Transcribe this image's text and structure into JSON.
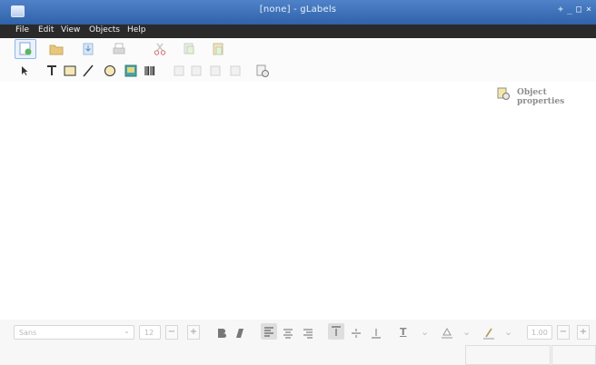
{
  "window": {
    "title": "[none] - gLabels",
    "controls": [
      "+",
      "_",
      "□",
      "×"
    ]
  },
  "menubar": {
    "items": [
      "File",
      "Edit",
      "View",
      "Objects",
      "Help"
    ]
  },
  "icons": {
    "toolbar1": [
      "new-icon",
      "open-icon",
      "save-icon",
      "print-icon",
      "cut-icon",
      "copy-icon",
      "paste-icon"
    ],
    "toolbar2": [
      "arrow-icon",
      "text-icon",
      "box-icon",
      "line-icon",
      "ellipse-icon",
      "image-icon",
      "barcode-icon",
      "align-left-icon",
      "align-center-icon",
      "align-right-icon",
      "align-top-icon",
      "merge-properties-icon"
    ]
  },
  "object_properties": {
    "label": "Object properties"
  },
  "format_bar": {
    "font_family_placeholder": "Sans",
    "font_size": "12",
    "minus": "−",
    "plus": "+",
    "line_width": "1.00",
    "text_color_glyph": "T",
    "chevron": "⌄"
  }
}
